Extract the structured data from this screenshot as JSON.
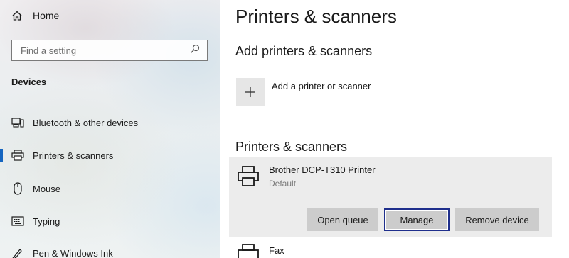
{
  "sidebar": {
    "home_label": "Home",
    "search_placeholder": "Find a setting",
    "section_label": "Devices",
    "items": [
      {
        "label": "Bluetooth & other devices",
        "icon": "bluetooth-devices-icon"
      },
      {
        "label": "Printers & scanners",
        "icon": "printer-icon",
        "selected": true
      },
      {
        "label": "Mouse",
        "icon": "mouse-icon"
      },
      {
        "label": "Typing",
        "icon": "keyboard-icon"
      },
      {
        "label": "Pen & Windows Ink",
        "icon": "pen-icon"
      }
    ]
  },
  "main": {
    "title": "Printers & scanners",
    "add_heading": "Add printers & scanners",
    "add_label": "Add a printer or scanner",
    "list_heading": "Printers & scanners",
    "printers": [
      {
        "name": "Brother DCP-T310 Printer",
        "status": "Default",
        "buttons": {
          "open_queue": "Open queue",
          "manage": "Manage",
          "remove": "Remove device"
        }
      },
      {
        "name": "Fax"
      }
    ]
  },
  "colors": {
    "accent": "#1565c0",
    "focus_border": "#1f2f8c",
    "button_bg": "#cccccc",
    "card_bg": "#ececec"
  }
}
